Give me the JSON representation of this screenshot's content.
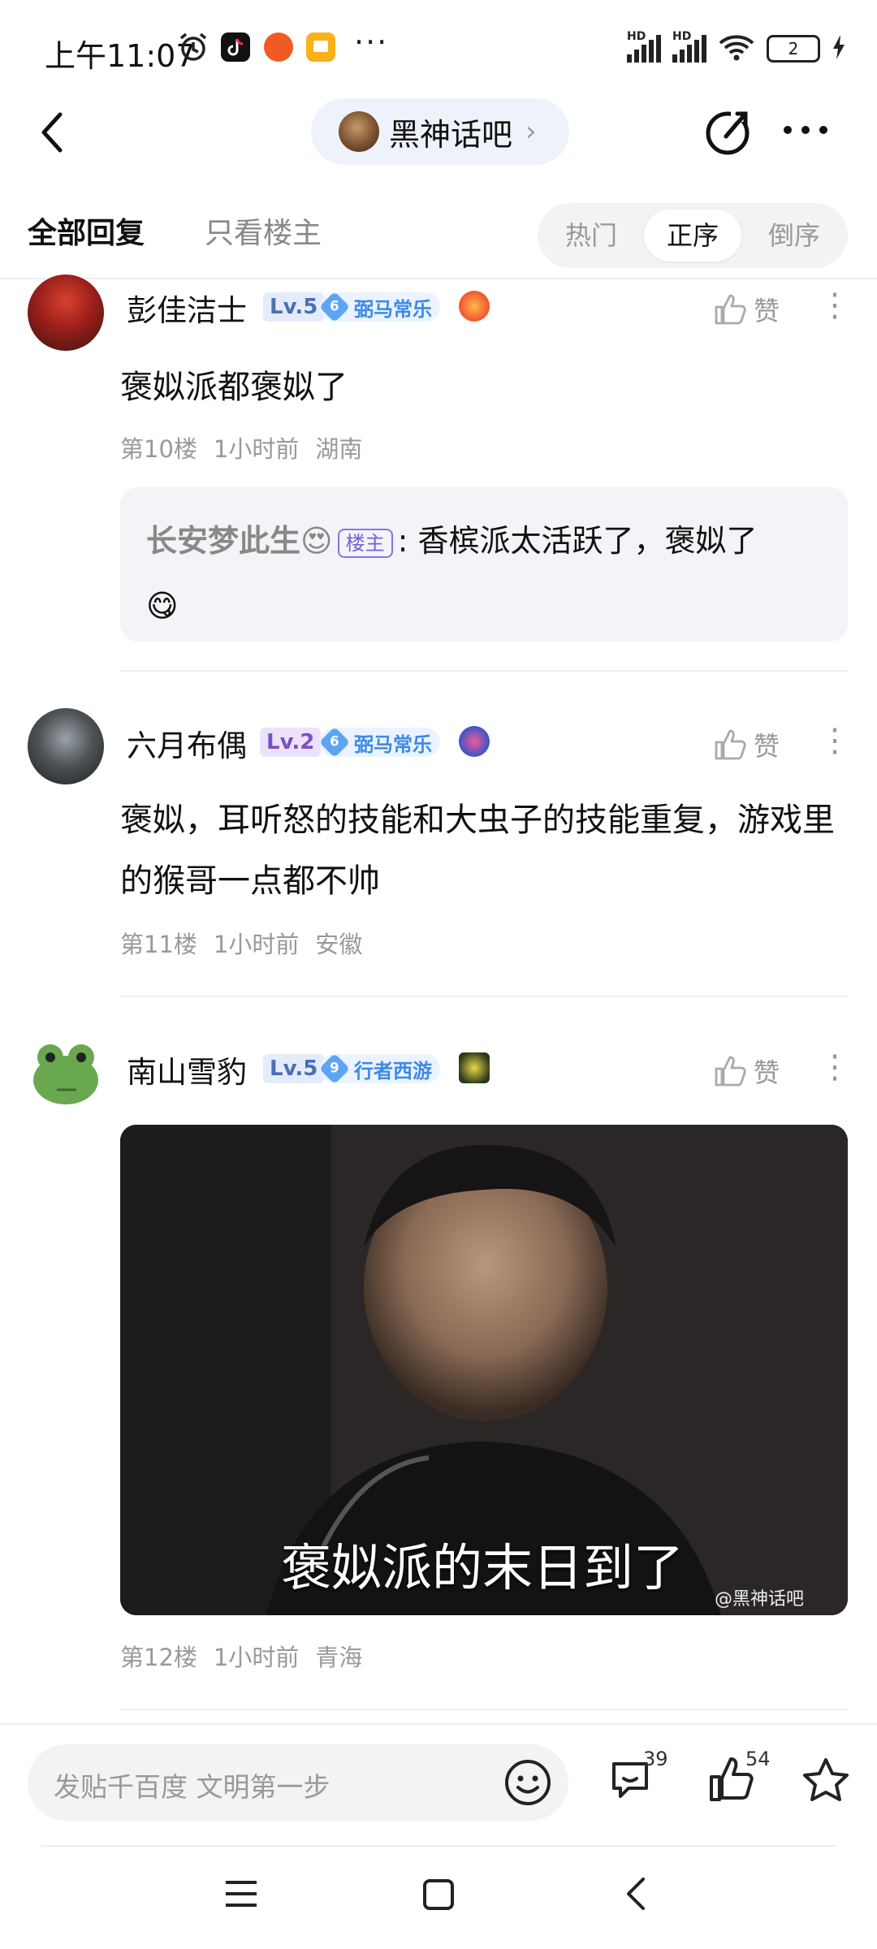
{
  "status_bar": {
    "time": "上午11:07",
    "more": "···",
    "battery": "2"
  },
  "header": {
    "forum_name": "黑神话吧",
    "chevron": "›"
  },
  "tabs": {
    "all_replies": "全部回复",
    "only_owner": "只看楼主"
  },
  "sort": {
    "options": [
      "热门",
      "正序",
      "倒序"
    ],
    "active": "正序"
  },
  "posts": [
    {
      "username": "彭佳洁士",
      "level": "Lv.5",
      "badge_num": "6",
      "badge_label": "弼马常乐",
      "content": "褒姒派都褒姒了",
      "floor": "第10楼",
      "time": "1小时前",
      "location": "湖南",
      "like_label": "赞",
      "quote": {
        "user": "长安梦此生😍",
        "owner_tag": "楼主",
        "colon": ":",
        "text": " 香槟派太活跃了，褒姒了",
        "emoji": "😋"
      }
    },
    {
      "username": "六月布偶",
      "level": "Lv.2",
      "badge_num": "6",
      "badge_label": "弼马常乐",
      "content": "褒姒，耳听怒的技能和大虫子的技能重复，游戏里的猴哥一点都不帅",
      "floor": "第11楼",
      "time": "1小时前",
      "location": "安徽",
      "like_label": "赞"
    },
    {
      "username": "南山雪豹",
      "level": "Lv.5",
      "badge_num": "9",
      "badge_label": "行者西游",
      "image_caption": "褒姒派的末日到了",
      "image_watermark": "@黑神话吧",
      "floor": "第12楼",
      "time": "1小时前",
      "location": "青海",
      "like_label": "赞"
    }
  ],
  "bottom_bar": {
    "input_placeholder": "发贴千百度 文明第一步",
    "comments_count": "39",
    "likes_count": "54"
  },
  "colors": {
    "accent_blue": "#3c8ae6",
    "level_purple": "#7a4fc6",
    "owner_tag": "#7a5fd6"
  }
}
